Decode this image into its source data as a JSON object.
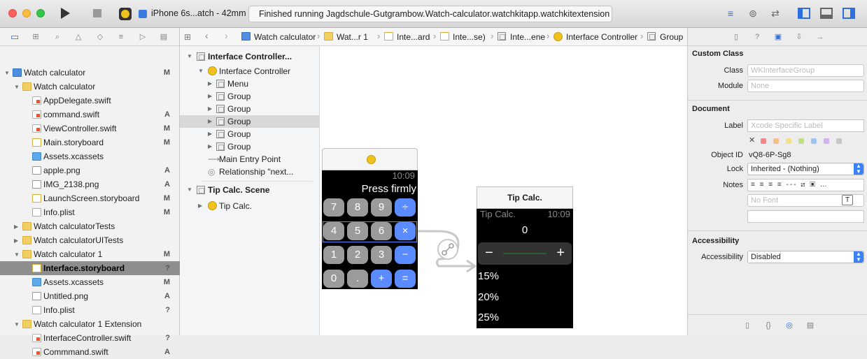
{
  "toolbar": {
    "scheme": "iPhone 6s...atch - 42mm",
    "activity": "Finished running Jagdschule-Gutgrambow.Watch-calculator.watchkitapp.watchkitextension o"
  },
  "navigator": {
    "items": [
      {
        "label": "Watch calculator",
        "status": "M"
      },
      {
        "label": "Watch calculator",
        "status": ""
      },
      {
        "label": "AppDelegate.swift",
        "status": ""
      },
      {
        "label": "command.swift",
        "status": "A"
      },
      {
        "label": "ViewController.swift",
        "status": "M"
      },
      {
        "label": "Main.storyboard",
        "status": "M"
      },
      {
        "label": "Assets.xcassets",
        "status": ""
      },
      {
        "label": "apple.png",
        "status": "A"
      },
      {
        "label": "IMG_2138.png",
        "status": "A"
      },
      {
        "label": "LaunchScreen.storyboard",
        "status": "M"
      },
      {
        "label": "Info.plist",
        "status": "M"
      },
      {
        "label": "Watch calculatorTests",
        "status": ""
      },
      {
        "label": "Watch calculatorUITests",
        "status": ""
      },
      {
        "label": "Watch calculator 1",
        "status": "M"
      },
      {
        "label": "Interface.storyboard",
        "status": "?"
      },
      {
        "label": "Assets.xcassets",
        "status": "M"
      },
      {
        "label": "Untitled.png",
        "status": "A"
      },
      {
        "label": "Info.plist",
        "status": "?"
      },
      {
        "label": "Watch calculator 1 Extension",
        "status": ""
      },
      {
        "label": "InterfaceController.swift",
        "status": "?"
      },
      {
        "label": "Commmand.swift",
        "status": "A"
      }
    ]
  },
  "jumpbar": {
    "crumbs": [
      "Watch calculator",
      "Wat...r 1",
      "Inte...ard",
      "Inte...se)",
      "Inte...ene",
      "Interface Controller",
      "Group"
    ]
  },
  "outline": {
    "items": [
      "Interface Controller...",
      "Interface Controller",
      "Menu",
      "Group",
      "Group",
      "Group",
      "Group",
      "Group",
      "Main Entry Point",
      "Relationship \"next...",
      "Tip Calc. Scene",
      "Tip Calc."
    ]
  },
  "calc_scene": {
    "time": "10:09",
    "display": "Press firmly",
    "keys": [
      [
        "7",
        "8",
        "9",
        "÷"
      ],
      [
        "4",
        "5",
        "6",
        "×"
      ],
      [
        "1",
        "2",
        "3",
        "−"
      ],
      [
        "0",
        ".",
        "+",
        "="
      ]
    ]
  },
  "tip_scene": {
    "title": "Tip Calc.",
    "screen_title": "Tip Calc.",
    "time": "10:09",
    "value": "0",
    "minus": "−",
    "plus": "+",
    "options": [
      "15%",
      "20%",
      "25%"
    ]
  },
  "inspector": {
    "custom_class_title": "Custom Class",
    "class_label": "Class",
    "class_placeholder": "WKInterfaceGroup",
    "module_label": "Module",
    "module_placeholder": "None",
    "document_title": "Document",
    "doc_label": "Label",
    "doc_label_placeholder": "Xcode Specific Label",
    "object_id_label": "Object ID",
    "object_id": "vQ8-6P-Sg8",
    "lock_label": "Lock",
    "lock_value": "Inherited - (Nothing)",
    "notes_label": "Notes",
    "font_placeholder": "No Font",
    "accessibility_title": "Accessibility",
    "accessibility_label": "Accessibility",
    "accessibility_value": "Disabled"
  },
  "colors": {
    "accent": "#3b82f6",
    "folder": "#f2cf63",
    "watch_blue": "#5a8cff",
    "watch_gray": "#9b9b9b"
  }
}
